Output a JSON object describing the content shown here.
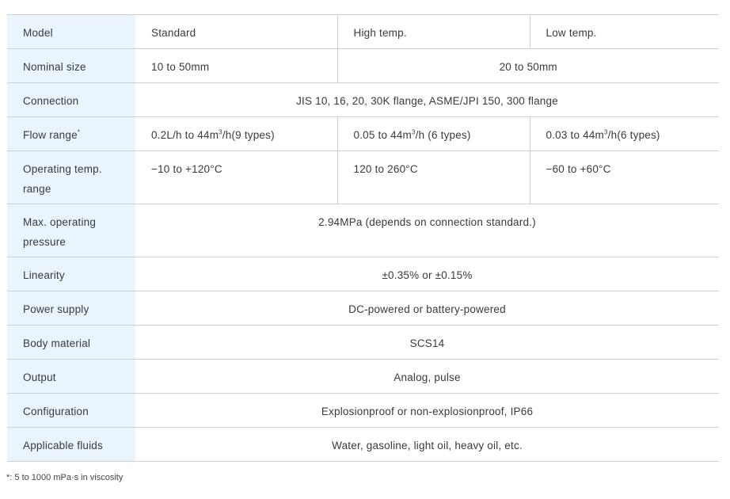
{
  "table": {
    "header": {
      "label": "Model",
      "standard": "Standard",
      "high_temp": "High temp.",
      "low_temp": "Low temp."
    },
    "nominal_size": {
      "label": "Nominal size",
      "standard": "10 to 50mm",
      "high_low": "20 to 50mm"
    },
    "connection": {
      "label": "Connection",
      "value": "JIS 10, 16, 20, 30K flange, ASME/JPI 150, 300 flange"
    },
    "flow_range": {
      "label": "Flow range",
      "label_mark": "*",
      "standard_pre": "0.2L/h to 44m",
      "standard_post": "/h(9 types)",
      "high_pre": "0.05 to 44m",
      "high_post": "/h (6 types)",
      "low_pre": "0.03 to 44m",
      "low_post": "/h(6 types)",
      "superscript": "3"
    },
    "operating_temp": {
      "label": "Operating temp. range",
      "standard": "−10 to +120°C",
      "high_temp": "120 to 260°C",
      "low_temp": "−60 to +60°C"
    },
    "max_pressure": {
      "label": "Max. operating pressure",
      "value": "2.94MPa (depends on connection standard.)"
    },
    "linearity": {
      "label": "Linearity",
      "value": "±0.35% or ±0.15%"
    },
    "power_supply": {
      "label": "Power supply",
      "value": "DC-powered or battery-powered"
    },
    "body_material": {
      "label": "Body material",
      "value": "SCS14"
    },
    "output": {
      "label": "Output",
      "value": "Analog, pulse"
    },
    "configuration": {
      "label": "Configuration",
      "value": "Explosionproof or non-explosionproof, IP66"
    },
    "applicable_fluids": {
      "label": "Applicable fluids",
      "value": "Water, gasoline, light oil, heavy oil, etc."
    }
  },
  "footnote": "*: 5 to 1000 mPa·s in viscosity",
  "colors": {
    "header_bg": "#eaf4fd",
    "border": "#cfcfcf",
    "text": "#3a3a3a"
  }
}
